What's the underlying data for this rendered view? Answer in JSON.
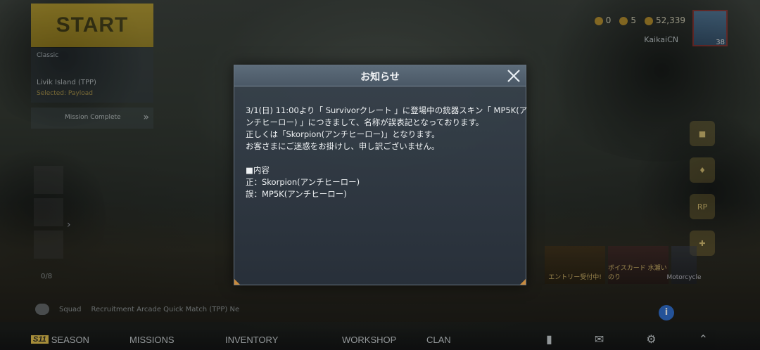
{
  "lobby": {
    "start_label": "START",
    "mode_small": "Classic",
    "mode_name": "Livik Island (TPP)",
    "mode_sub": "Selected: Payload",
    "mission_label": "Mission Complete",
    "slot_count": "0/8",
    "player_name": "KaikaiCN",
    "level": "38",
    "currency": [
      {
        "icon": "token-icon",
        "value": "0"
      },
      {
        "icon": "uc-coin-icon",
        "value": "5"
      },
      {
        "icon": "bp-coin-icon",
        "value": "52,339"
      }
    ],
    "rp_label": "RP",
    "event_entry": "エントリー受付中!",
    "event_voice": "ボイスカード 水瀬いのり",
    "event_moto": "Motorcycle",
    "chat_mode": "Squad",
    "chat_text": "Recruitment Arcade Quick Match (TPP) Ne"
  },
  "bottom_nav": {
    "season_tag": "S11",
    "season": "SEASON",
    "missions": "MISSIONS",
    "inventory": "INVENTORY",
    "workshop": "WORKSHOP",
    "clan": "CLAN"
  },
  "dialog": {
    "title": "お知らせ",
    "lines": [
      "3/1(日) 11:00より「 Survivorクレート 」に登場中の銃器スキン「 MP5K(ア",
      "ンチヒーロー) 」につきまして、名称が誤表記となっております。",
      "正しくは「Skorpion(アンチヒーロー)」となります。",
      "お客さまにご迷惑をお掛けし、申し訳ございません。"
    ],
    "section_heading": "■内容",
    "correct_line": "正：Skorpion(アンチヒーロー)",
    "wrong_line": "誤：MP5K(アンチヒーロー)"
  },
  "colors": {
    "accent_gold": "#c9a622",
    "corner_orange": "#c98a3c",
    "info_blue": "#2a6bd1"
  }
}
